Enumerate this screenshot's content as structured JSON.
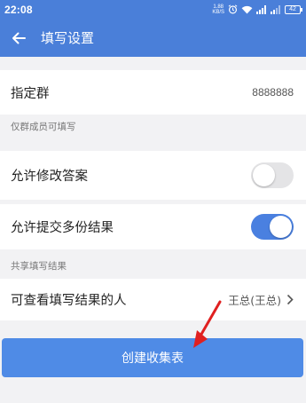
{
  "status_bar": {
    "time": "22:08",
    "net_speed_value": "1.88",
    "net_speed_unit": "KB/S",
    "battery": "42"
  },
  "app_bar": {
    "title": "填写设置"
  },
  "group": {
    "label": "指定群",
    "value": "8888888",
    "caption": "仅群成员可填写"
  },
  "allow_edit": {
    "label": "允许修改答案",
    "enabled": false
  },
  "allow_multiple": {
    "label": "允许提交多份结果",
    "enabled": true
  },
  "share": {
    "caption": "共享填写结果",
    "viewer_label": "可查看填写结果的人",
    "viewer_value": "王总(王总)"
  },
  "create_button": {
    "label": "创建收集表"
  },
  "colors": {
    "primary": "#4a7fd9",
    "button": "#4f8be6",
    "annotation_arrow": "#e02020"
  }
}
